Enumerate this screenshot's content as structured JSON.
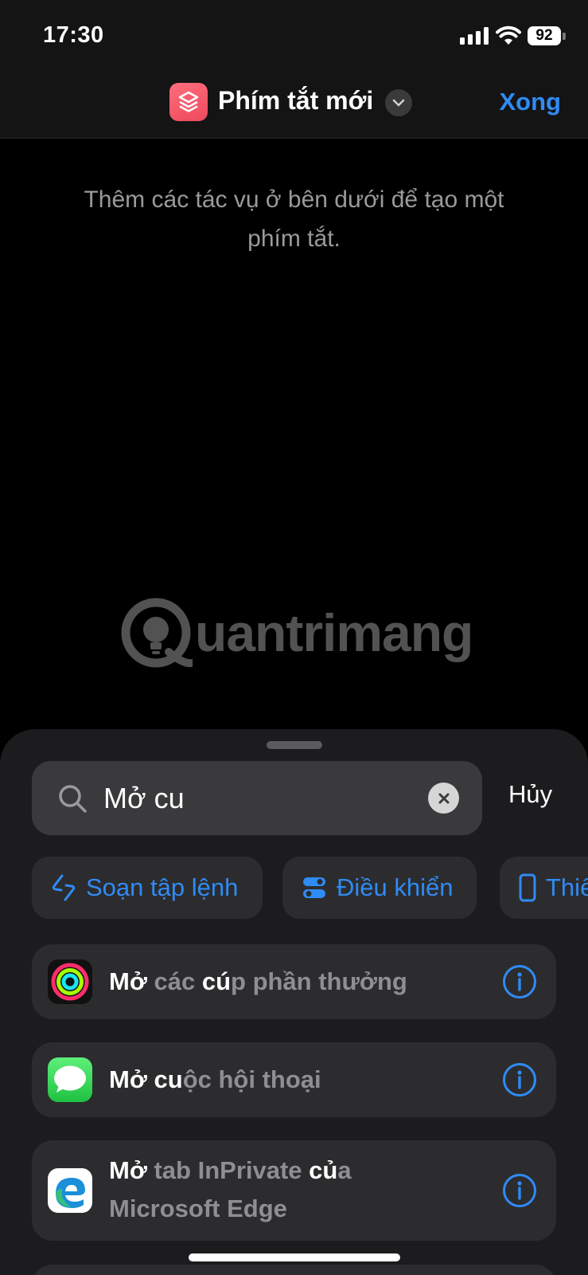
{
  "status_bar": {
    "time": "17:30",
    "battery": "92",
    "icons": [
      "signal-icon",
      "wifi-icon",
      "battery-icon"
    ]
  },
  "nav": {
    "title": "Phím tắt mới",
    "done_label": "Xong",
    "app_icon": "shortcuts-app-icon",
    "chevron_icon": "chevron-down-icon"
  },
  "empty_state": {
    "hint": "Thêm các tác vụ ở bên dưới để tạo một phím tắt."
  },
  "watermark": {
    "text": "uantrimang"
  },
  "sheet": {
    "search": {
      "value": "Mở cu",
      "placeholder": "",
      "icon": "search-icon",
      "clear_icon": "clear-icon"
    },
    "cancel_label": "Hủy",
    "chips": [
      {
        "label": "Soạn tập lệnh",
        "icon": "script-icon"
      },
      {
        "label": "Điều khiển",
        "icon": "toggle-icon"
      },
      {
        "label": "Thiết bị",
        "icon": "device-icon"
      }
    ],
    "actions": [
      {
        "parts": [
          "Mở",
          " các ",
          "cú",
          "p phần thưởng"
        ],
        "app_icon": "activity-rings-icon"
      },
      {
        "parts": [
          "Mở",
          " ",
          "cu",
          "ộc hội thoại"
        ],
        "app_icon": "messages-icon"
      },
      {
        "parts": [
          "Mở",
          " tab InPrivate ",
          "củ",
          "a Microsoft Edge"
        ],
        "app_icon": "edge-icon"
      }
    ],
    "info_icon": "info-icon"
  },
  "colors": {
    "accent": "#2f8bf5",
    "sheet_bg": "#1c1c1e",
    "row_bg": "#2c2c2e",
    "shortcuts_icon": "#f0566a",
    "messages_green": "#34c759"
  }
}
